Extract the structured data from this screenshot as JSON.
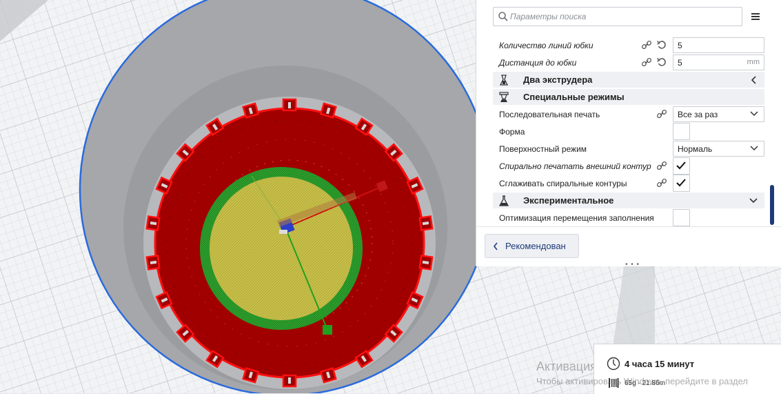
{
  "search": {
    "placeholder": "Параметры поиска"
  },
  "settings": {
    "skirt_lines": {
      "label": "Количество линий юбки",
      "value": "5"
    },
    "skirt_distance": {
      "label": "Дистанция до юбки",
      "value": "5",
      "unit": "mm"
    },
    "category_dual": {
      "label": "Два экструдера",
      "icon": "dual-extruder-icon"
    },
    "category_special": {
      "label": "Специальные режимы",
      "icon": "special-modes-icon"
    },
    "print_sequence": {
      "label": "Последовательная печать",
      "value": "Все за раз"
    },
    "mold": {
      "label": "Форма",
      "checked": false
    },
    "surface_mode": {
      "label": "Поверхностный режим",
      "value": "Нормаль"
    },
    "spiralize": {
      "label": "Спирально печатать внешний контур",
      "checked": true
    },
    "smooth_spiral": {
      "label": "Сглаживать спиральные контуры",
      "checked": true
    },
    "category_experimental": {
      "label": "Экспериментальное",
      "icon": "experimental-flask-icon"
    },
    "infill_travel": {
      "label": "Оптимизация перемещения заполнения",
      "checked": false
    }
  },
  "footer": {
    "recommended_label": "Рекомендован",
    "drag_handle": "• • •"
  },
  "print_info": {
    "time": "4 часа 15 минут",
    "material": "65g · 21.86m"
  },
  "watermark": {
    "line1": "Активация Windows",
    "line2": "Чтобы активировать Windows, перейдите в раздел"
  },
  "colors": {
    "brand_blue": "#1e3a78",
    "build_plate": "#f2f3f5",
    "skirt_outline": "#2a6bdc",
    "wall_red": "#a00000",
    "wall_outline": "#ff1010",
    "inner_green": "#2ea02e",
    "top_yellow": "#c8c048"
  }
}
